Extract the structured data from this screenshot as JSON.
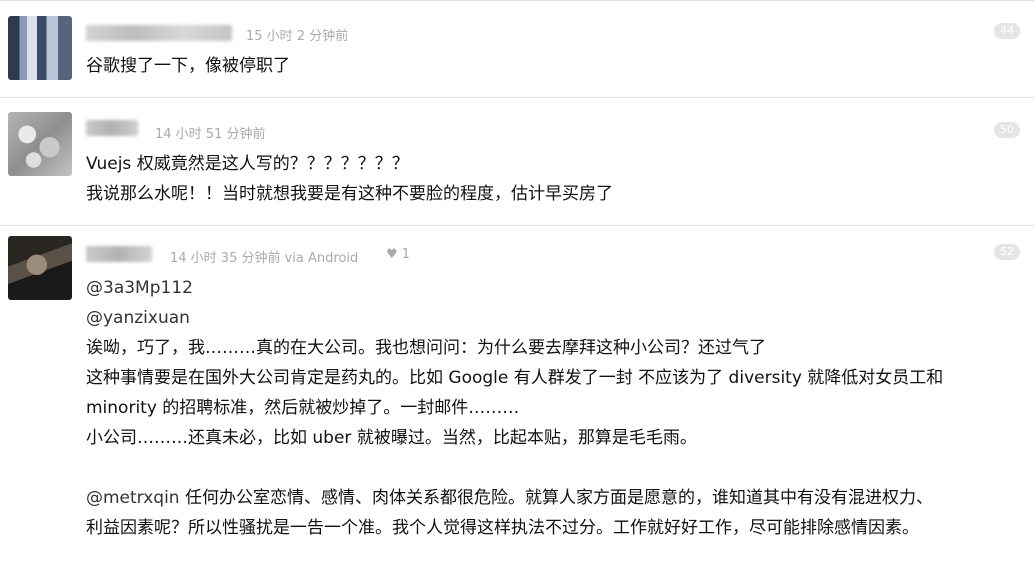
{
  "replies": [
    {
      "time": "15 小时 2 分钟前",
      "floor": "44",
      "lines": [
        "谷歌搜了一下，像被停职了"
      ]
    },
    {
      "time": "14 小时 51 分钟前",
      "floor": "50",
      "lines": [
        "Vuejs 权威竟然是这人写的？？？？？？？",
        "我说那么水呢！！当时就想我要是有这种不要脸的程度，估计早买房了"
      ]
    },
    {
      "time": "14 小时 35 分钟前 via Android",
      "thanks": "♥ 1",
      "floor": "52",
      "mention1": "@3a3Mp112",
      "mention2": "@yanzixuan",
      "lines": [
        "诶呦，巧了，我………真的在大公司。我也想问问：为什么要去摩拜这种小公司？还过气了",
        "这种事情要是在国外大公司肯定是药丸的。比如 Google 有人群发了一封 不应该为了 diversity 就降低对女员工和",
        "minority 的招聘标准，然后就被炒掉了。一封邮件………",
        "小公司………还真未必，比如 uber 就被曝过。当然，比起本贴，那算是毛毛雨。"
      ],
      "mention3": "@metrxqin",
      "para2_first": " 任何办公室恋情、感情、肉体关系都很危险。就算人家方面是愿意的，谁知道其中有没有混进权力、",
      "para2_second": "利益因素呢？所以性骚扰是一告一个准。我个人觉得这样执法不过分。工作就好好工作，尽可能排除感情因素。"
    }
  ]
}
